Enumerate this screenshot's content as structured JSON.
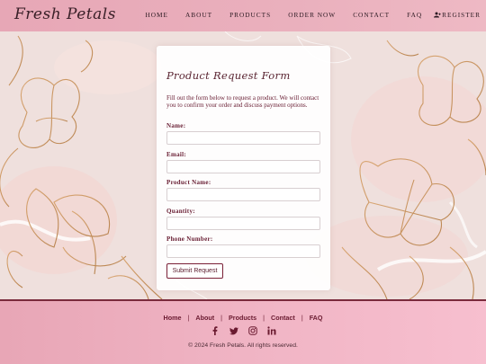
{
  "header": {
    "logo": "Fresh Petals",
    "nav": [
      {
        "label": "HOME"
      },
      {
        "label": "ABOUT"
      },
      {
        "label": "PRODUCTS"
      },
      {
        "label": "ORDER NOW"
      },
      {
        "label": "CONTACT"
      },
      {
        "label": "FAQ"
      }
    ],
    "register_label": "REGISTER",
    "register_icon": "user-plus-icon"
  },
  "form": {
    "title": "Product Request Form",
    "intro": "Fill out the form below to request a product. We will contact you to confirm your order and discuss payment options.",
    "fields": [
      {
        "label": "Name:",
        "value": ""
      },
      {
        "label": "Email:",
        "value": ""
      },
      {
        "label": "Product Name:",
        "value": ""
      },
      {
        "label": "Quantity:",
        "value": ""
      },
      {
        "label": "Phone Number:",
        "value": ""
      }
    ],
    "submit_label": "Submit Request"
  },
  "footer": {
    "links": [
      "Home",
      "About",
      "Products",
      "Contact",
      "FAQ"
    ],
    "socials": [
      "facebook-icon",
      "twitter-icon",
      "instagram-icon",
      "linkedin-icon"
    ],
    "copyright": "© 2024 Fresh Petals. All rights reserved."
  },
  "colors": {
    "header_bg": "#e7a7b6",
    "footer_bg": "#f0b4c4",
    "accent": "#7a1f36",
    "text_dark": "#6a2035"
  }
}
